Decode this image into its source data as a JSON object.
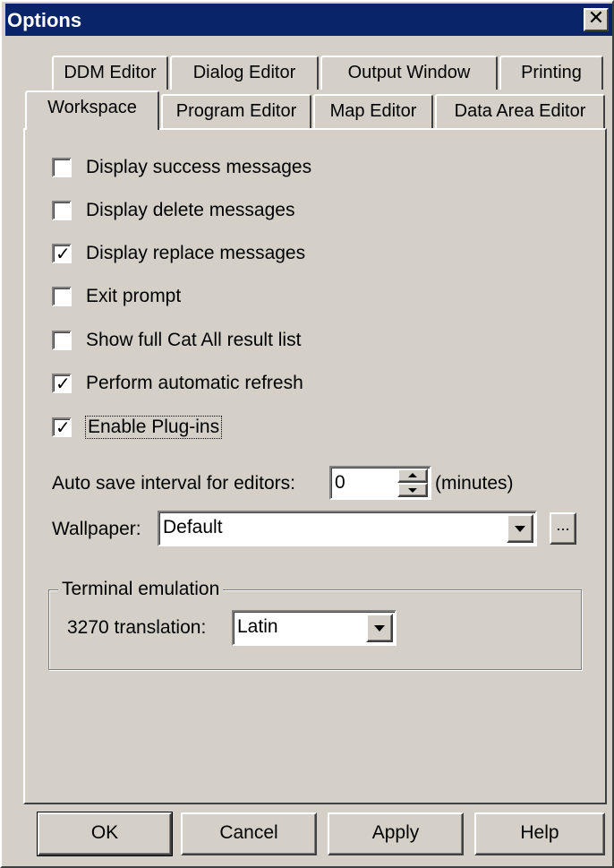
{
  "window": {
    "title": "Options",
    "close_glyph": "✕"
  },
  "tabs_back": [
    {
      "label": "DDM Editor"
    },
    {
      "label": "Dialog Editor"
    },
    {
      "label": "Output Window"
    },
    {
      "label": "Printing"
    }
  ],
  "tabs_front": [
    {
      "label": "Workspace",
      "active": true
    },
    {
      "label": "Program Editor"
    },
    {
      "label": "Map Editor"
    },
    {
      "label": "Data Area Editor"
    }
  ],
  "checkboxes": [
    {
      "label": "Display success messages",
      "checked": false
    },
    {
      "label": "Display delete messages",
      "checked": false
    },
    {
      "label": "Display replace messages",
      "checked": true
    },
    {
      "label": "Exit prompt",
      "checked": false
    },
    {
      "label": "Show full Cat All result list",
      "checked": false
    },
    {
      "label": "Perform automatic refresh",
      "checked": true
    },
    {
      "label": "Enable Plug-ins",
      "checked": true
    }
  ],
  "check_glyph": "✓",
  "autosave": {
    "label": "Auto save interval for editors:",
    "value": "0",
    "unit": "(minutes)"
  },
  "wallpaper": {
    "label": "Wallpaper:",
    "value": "Default",
    "browse_label": "..."
  },
  "terminal": {
    "group_title": "Terminal emulation",
    "translation_label": "3270 translation:",
    "translation_value": "Latin"
  },
  "buttons": {
    "ok": "OK",
    "cancel": "Cancel",
    "apply": "Apply",
    "help": "Help"
  },
  "colors": {
    "titlebar": "#0a246a",
    "face": "#d4d0c8"
  }
}
